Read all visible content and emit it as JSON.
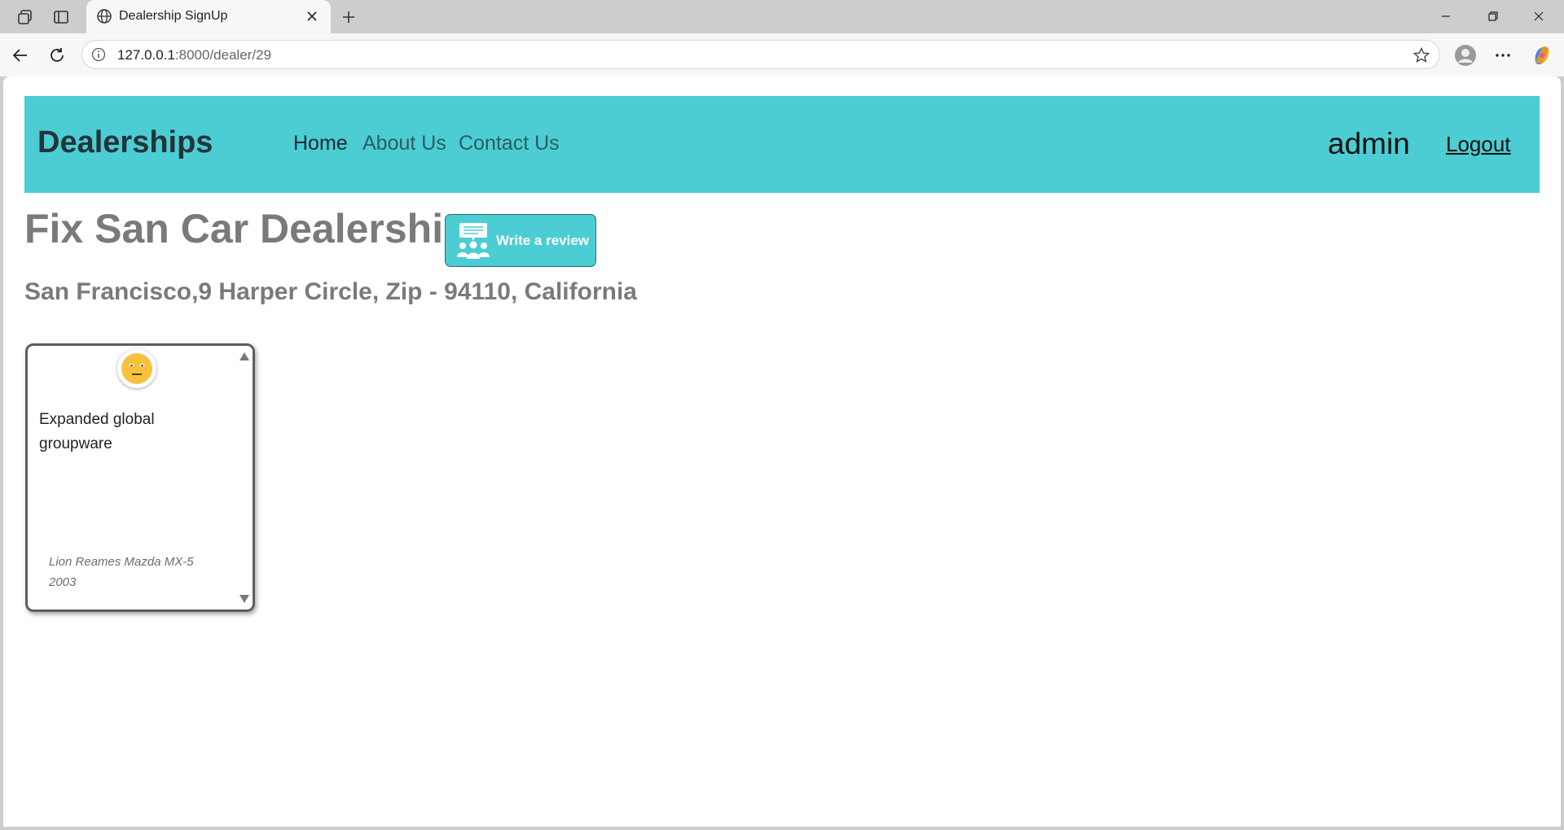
{
  "browser": {
    "tab_title": "Dealership SignUp",
    "url_host": "127.0.0.1",
    "url_path": ":8000/dealer/29",
    "icons": [
      "workspaces-icon",
      "vertical-tabs-icon",
      "globe-icon",
      "close-icon",
      "plus-icon",
      "minimize-icon",
      "restore-icon",
      "window-close-icon",
      "back-icon",
      "reload-icon",
      "info-icon",
      "star-icon",
      "profile-icon",
      "more-icon",
      "copilot-icon"
    ]
  },
  "navbar": {
    "brand": "Dealerships",
    "links": [
      {
        "label": "Home"
      },
      {
        "label": "About Us"
      },
      {
        "label": "Contact Us"
      }
    ],
    "user": "admin",
    "logout": "Logout",
    "background": "#4bcdd3"
  },
  "dealer": {
    "name": "Fix San Car Dealership",
    "address": "San Francisco,9 Harper Circle, Zip - 94110, California",
    "review_button": "Write a review"
  },
  "reviews": [
    {
      "sentiment_icon": "neutral-face-icon",
      "text": "Expanded global groupware",
      "meta": "Lion Reames Mazda MX-5 2003"
    }
  ]
}
